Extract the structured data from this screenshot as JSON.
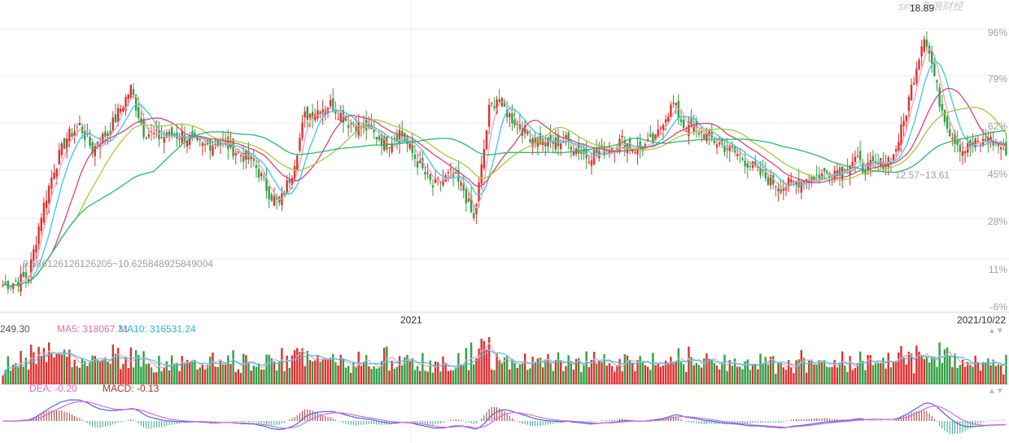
{
  "watermark": "sina 新浪财经",
  "chart_data": {
    "type": "candlestick",
    "y_axis_ticks": [
      "96%",
      "79%",
      "62%",
      "45%",
      "28%",
      "11%",
      "-6%"
    ],
    "x_axis_labels": [
      "2021",
      "2021/10/22"
    ],
    "annotations": {
      "high": "18.89",
      "low_left": "9.586126126126205~10.625848925849004",
      "mid_right": "12.57~13.61"
    },
    "volume_legend": [
      {
        "name": "249.30",
        "color": "#555555"
      },
      {
        "name": "MA5: 318067.31",
        "color": "#e070a8"
      },
      {
        "name": "MA10: 316531.24",
        "color": "#2ab3d6"
      }
    ],
    "macd_legend": [
      {
        "name": "DEA: -0.20",
        "color": "#d86ad8"
      },
      {
        "name": "MACD: -0.13",
        "color": "#b03030"
      }
    ],
    "price_anchors": [
      [
        0,
        10.2
      ],
      [
        5,
        10.3
      ],
      [
        10,
        10.5
      ],
      [
        15,
        12.5
      ],
      [
        20,
        14.0
      ],
      [
        25,
        15.0
      ],
      [
        30,
        15.4
      ],
      [
        35,
        14.6
      ],
      [
        42,
        15.3
      ],
      [
        50,
        16.6
      ],
      [
        55,
        15.2
      ],
      [
        62,
        15.0
      ],
      [
        70,
        15.1
      ],
      [
        78,
        14.7
      ],
      [
        85,
        14.9
      ],
      [
        92,
        14.5
      ],
      [
        98,
        14.2
      ],
      [
        104,
        13.2
      ],
      [
        108,
        12.8
      ],
      [
        113,
        13.9
      ],
      [
        118,
        15.7
      ],
      [
        123,
        15.9
      ],
      [
        128,
        16.1
      ],
      [
        135,
        15.5
      ],
      [
        142,
        15.3
      ],
      [
        150,
        14.8
      ],
      [
        155,
        15.2
      ],
      [
        162,
        14.2
      ],
      [
        168,
        13.4
      ],
      [
        175,
        13.8
      ],
      [
        180,
        13.3
      ],
      [
        184,
        12.3
      ],
      [
        187,
        14.0
      ],
      [
        190,
        15.9
      ],
      [
        193,
        16.3
      ],
      [
        198,
        15.7
      ],
      [
        205,
        15.1
      ],
      [
        212,
        14.8
      ],
      [
        220,
        14.9
      ],
      [
        228,
        14.4
      ],
      [
        235,
        14.6
      ],
      [
        242,
        14.9
      ],
      [
        248,
        14.6
      ],
      [
        255,
        14.9
      ],
      [
        258,
        15.6
      ],
      [
        262,
        16.1
      ],
      [
        266,
        15.4
      ],
      [
        272,
        15.2
      ],
      [
        280,
        14.8
      ],
      [
        288,
        14.4
      ],
      [
        296,
        13.8
      ],
      [
        304,
        13.4
      ],
      [
        312,
        13.6
      ],
      [
        320,
        13.8
      ],
      [
        328,
        14.0
      ],
      [
        333,
        14.3
      ],
      [
        336,
        14.0
      ],
      [
        342,
        14.1
      ],
      [
        348,
        14.4
      ],
      [
        352,
        15.5
      ],
      [
        356,
        17.0
      ],
      [
        360,
        18.4
      ],
      [
        363,
        17.4
      ],
      [
        366,
        16.2
      ],
      [
        370,
        15.2
      ],
      [
        375,
        14.6
      ],
      [
        380,
        14.8
      ],
      [
        386,
        14.9
      ],
      [
        392,
        14.6
      ]
    ],
    "ylim": [
      9.4,
      18.9
    ]
  }
}
